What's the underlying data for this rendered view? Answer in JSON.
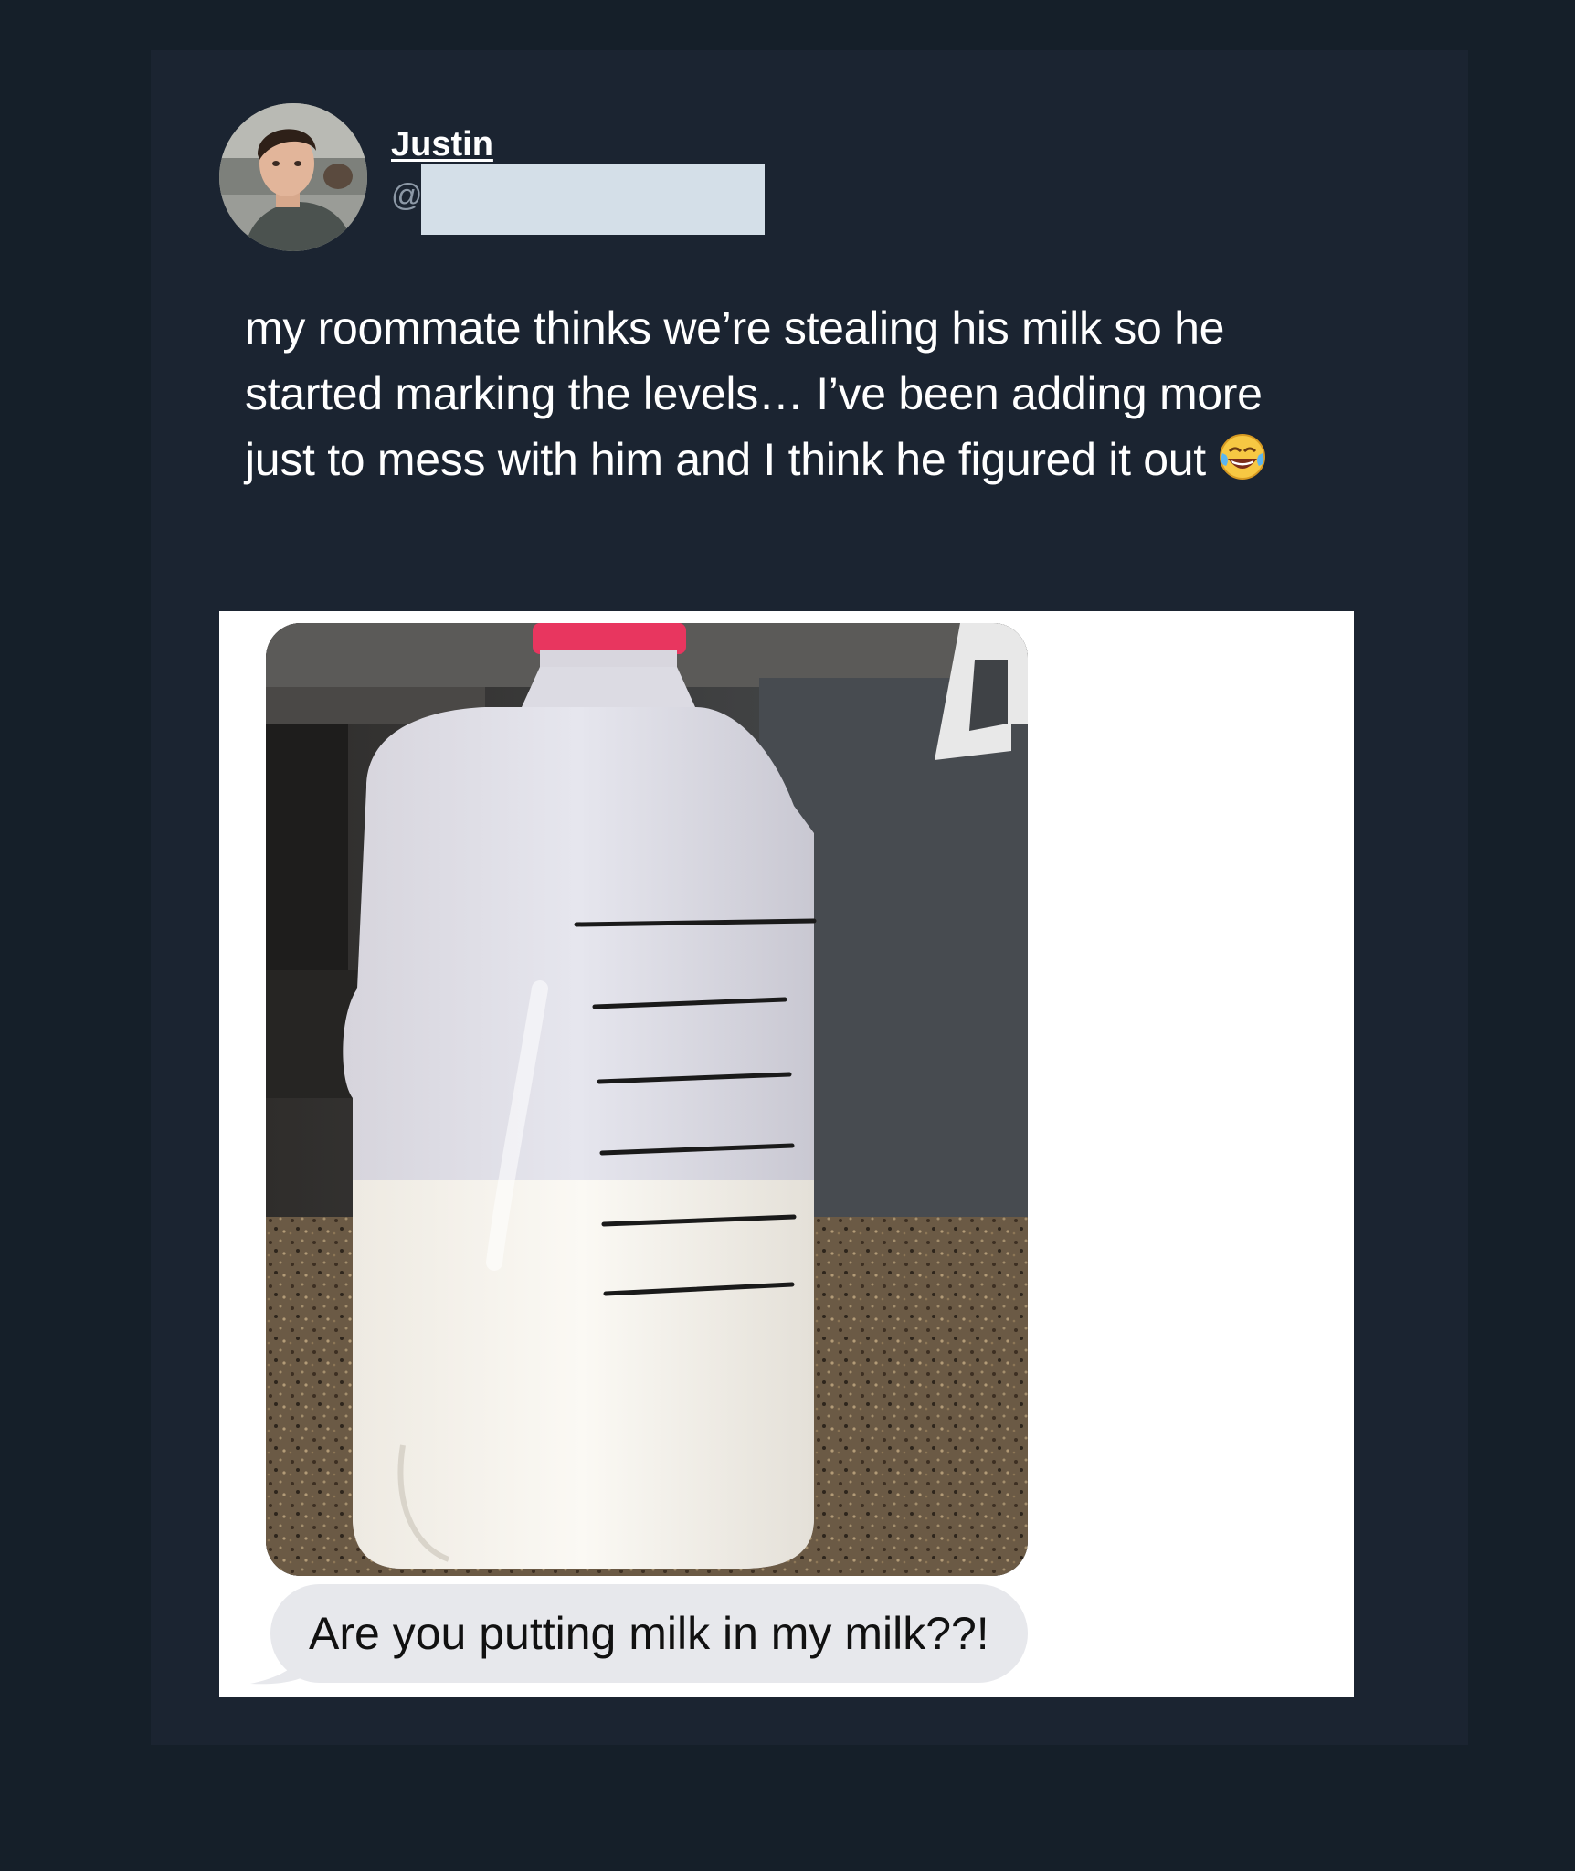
{
  "tweet": {
    "author": {
      "display_name": "Justin",
      "handle_prefix": "@"
    },
    "text": "my roommate thinks we’re stealing his milk so he started marking the levels… I’ve been adding more just to mess with him and I think he figured it out",
    "emoji_icon": "face-with-tears-of-joy-icon"
  },
  "attachment": {
    "message_text": "Are you putting milk in my milk??!",
    "marker_lines_count": 6
  },
  "colors": {
    "page_background": "#151f29",
    "card_background": "#1b2431",
    "text_primary": "#ffffff",
    "redaction": "#d4dfe8",
    "message_bubble": "#e7e8ec",
    "milk_cap": "#e8365f"
  }
}
